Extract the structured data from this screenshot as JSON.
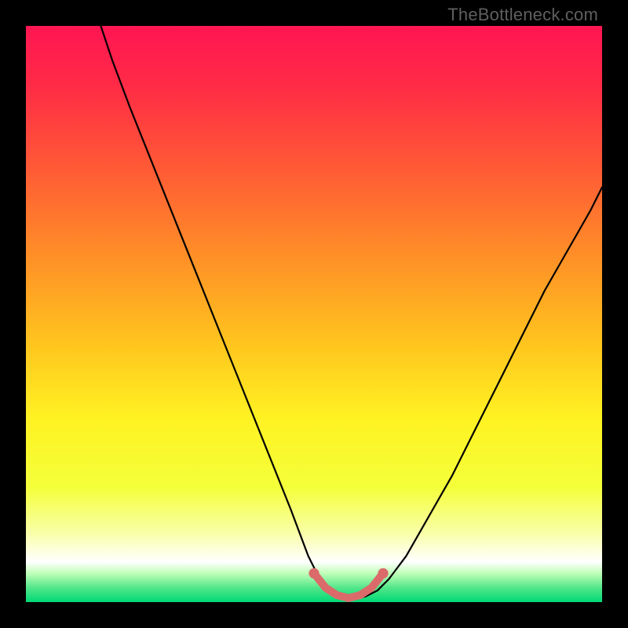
{
  "watermark": "TheBottleneck.com",
  "colors": {
    "frame": "#000000",
    "gradient_stops": [
      {
        "offset": 0.0,
        "color": "#ff1552"
      },
      {
        "offset": 0.1,
        "color": "#ff2a46"
      },
      {
        "offset": 0.25,
        "color": "#ff5b35"
      },
      {
        "offset": 0.4,
        "color": "#ff8f27"
      },
      {
        "offset": 0.55,
        "color": "#ffc41e"
      },
      {
        "offset": 0.68,
        "color": "#fff222"
      },
      {
        "offset": 0.8,
        "color": "#f4ff3a"
      },
      {
        "offset": 0.88,
        "color": "#f9ffa8"
      },
      {
        "offset": 0.93,
        "color": "#ffffff"
      },
      {
        "offset": 0.95,
        "color": "#c0ffb8"
      },
      {
        "offset": 0.975,
        "color": "#53e689"
      },
      {
        "offset": 1.0,
        "color": "#00d977"
      }
    ],
    "curve": "#000000",
    "segment": "#db6b6b"
  },
  "chart_data": {
    "type": "line",
    "title": "",
    "xlabel": "",
    "ylabel": "",
    "x_range": [
      0,
      100
    ],
    "y_range": [
      0,
      100
    ],
    "series": [
      {
        "name": "curve",
        "x": [
          13,
          15,
          18,
          22,
          26,
          30,
          34,
          38,
          42,
          46,
          49,
          51,
          53,
          55,
          57,
          59,
          61,
          63,
          66,
          70,
          74,
          78,
          82,
          86,
          90,
          94,
          98,
          100
        ],
        "y": [
          100,
          94,
          86,
          76,
          66,
          56,
          46,
          36,
          26,
          16,
          8,
          4,
          2,
          1,
          0.5,
          1,
          2,
          4,
          8,
          15,
          22,
          30,
          38,
          46,
          54,
          61,
          68,
          72
        ]
      }
    ],
    "highlight_segment": {
      "points": [
        {
          "x": 50,
          "y": 5
        },
        {
          "x": 52,
          "y": 2.5
        },
        {
          "x": 54,
          "y": 1.2
        },
        {
          "x": 56,
          "y": 0.7
        },
        {
          "x": 58,
          "y": 1.2
        },
        {
          "x": 60,
          "y": 2.5
        },
        {
          "x": 62,
          "y": 5
        }
      ],
      "endpoint_radius_pct": 0.9
    }
  }
}
